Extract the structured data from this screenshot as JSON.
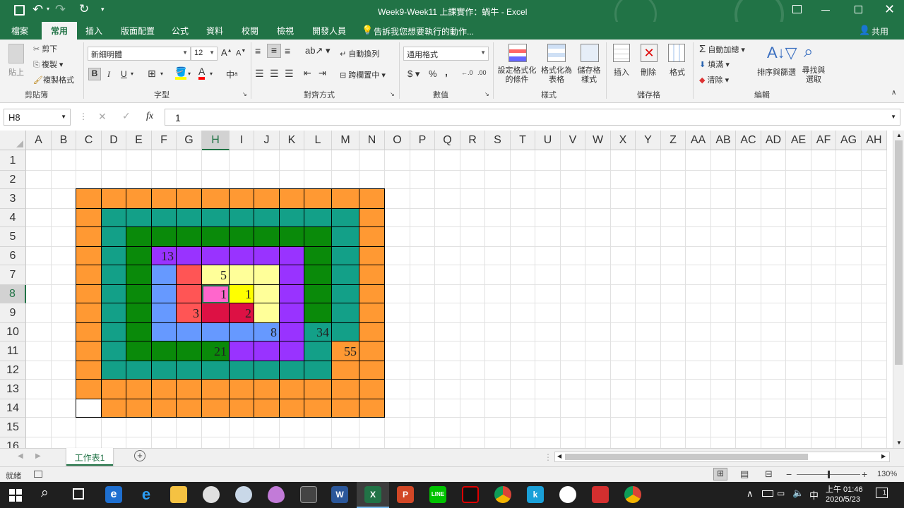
{
  "window": {
    "title": "Week9-Week11 上課實作：蝸牛 - Excel"
  },
  "tabs": [
    {
      "label": "檔案",
      "active": false
    },
    {
      "label": "常用",
      "active": true
    },
    {
      "label": "插入",
      "active": false
    },
    {
      "label": "版面配置",
      "active": false
    },
    {
      "label": "公式",
      "active": false
    },
    {
      "label": "資料",
      "active": false
    },
    {
      "label": "校閱",
      "active": false
    },
    {
      "label": "檢視",
      "active": false
    },
    {
      "label": "開發人員",
      "active": false
    }
  ],
  "tellme": "告訴我您想要執行的動作...",
  "share": "共用",
  "ribbon": {
    "clipboard": {
      "paste": "貼上",
      "cut": "剪下",
      "copy": "複製",
      "format_painter": "複製格式",
      "label": "剪貼簿"
    },
    "font": {
      "name": "新細明體",
      "size": "12",
      "bold": "B",
      "italic": "I",
      "underline": "U",
      "label": "字型"
    },
    "alignment": {
      "wrap": "自動換列",
      "merge": "跨欄置中",
      "label": "對齊方式"
    },
    "number": {
      "format": "通用格式",
      "currency": "$",
      "percent": "%",
      "comma": ",",
      "label": "數值"
    },
    "styles": {
      "cond": "設定格式化的條件",
      "table": "格式化為表格",
      "cell": "儲存格樣式",
      "label": "樣式"
    },
    "cells": {
      "insert": "插入",
      "delete": "刪除",
      "format": "格式",
      "label": "儲存格"
    },
    "editing": {
      "autosum": "自動加總",
      "fill": "填滿",
      "clear": "清除",
      "sort": "排序與篩選",
      "find": "尋找與選取",
      "label": "編輯"
    }
  },
  "formula_bar": {
    "name_box": "H8",
    "value": "1",
    "fx": "fx"
  },
  "columns": [
    "A",
    "B",
    "C",
    "D",
    "E",
    "F",
    "G",
    "H",
    "I",
    "J",
    "K",
    "L",
    "M",
    "N",
    "O",
    "P",
    "Q",
    "R",
    "S",
    "T",
    "U",
    "V",
    "W",
    "X",
    "Y",
    "Z",
    "AA",
    "AB",
    "AC",
    "AD",
    "AE",
    "AF",
    "AG",
    "AH"
  ],
  "rows": [
    "1",
    "2",
    "3",
    "4",
    "5",
    "6",
    "7",
    "8",
    "9",
    "10",
    "11",
    "12",
    "13",
    "14",
    "15",
    "16"
  ],
  "selected": {
    "col": "H",
    "row": "8"
  },
  "colors": {
    "orange": "#ff9933",
    "teal": "#13a088",
    "green": "#0a8a0a",
    "purple": "#9933ff",
    "blue": "#6699ff",
    "red": "#ff5555",
    "lightyellow": "#ffff99",
    "yellow": "#ffff00",
    "pink": "#ff66cc",
    "crimson": "#dd1144",
    "white": "#ffffff"
  },
  "cells": [
    {
      "ref": "F6",
      "value": "13"
    },
    {
      "ref": "H7",
      "value": "5"
    },
    {
      "ref": "H8",
      "value": "1"
    },
    {
      "ref": "I8",
      "value": "1"
    },
    {
      "ref": "G9",
      "value": "3"
    },
    {
      "ref": "I9",
      "value": "2"
    },
    {
      "ref": "J10",
      "value": "8"
    },
    {
      "ref": "L10",
      "value": "34"
    },
    {
      "ref": "H11",
      "value": "21"
    },
    {
      "ref": "M11",
      "value": "55"
    }
  ],
  "sheet_tabs": [
    {
      "label": "工作表1",
      "active": true
    }
  ],
  "status": {
    "ready": "就緒",
    "zoom": "130%"
  },
  "taskbar": {
    "ime": "中",
    "time": "上午 01:46",
    "date": "2020/5/23",
    "notif": "1"
  }
}
